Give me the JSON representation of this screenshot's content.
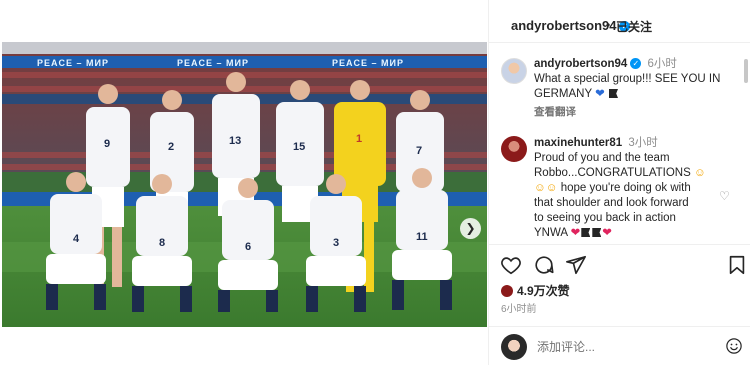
{
  "photo": {
    "banner_texts": [
      "PEACE – МИР",
      "PEACE – МИР",
      "PEACE – МИР"
    ],
    "back_row_numbers": [
      "9",
      "2",
      "13",
      "15",
      "1",
      "7"
    ],
    "front_row_numbers": [
      "4",
      "8",
      "6",
      "3",
      "11"
    ],
    "slide_count": 6,
    "active_slide": 1
  },
  "header": {
    "username": "andyrobertson94",
    "separator": "•",
    "follow_status": "已关注"
  },
  "comments": [
    {
      "username": "andyrobertson94",
      "time": "6小时",
      "text_line1": "What a special group!!! SEE YOU IN",
      "text_line2": "GERMANY",
      "translate": "查看翻译"
    },
    {
      "username": "maxinehunter81",
      "time": "3小时",
      "text_a": "Proud of you and the team",
      "text_b": "Robbo...CONGRATULATIONS",
      "text_c": "hope you're doing ok with",
      "text_d": "that shoulder and look forward",
      "text_e": "to seeing you back in action",
      "text_f": "YNWA"
    }
  ],
  "likes": "4.9万次赞",
  "post_time": "6小时前",
  "add_comment": {
    "placeholder": "添加评论..."
  },
  "colors": {
    "verified": "#0095f6",
    "heart": "#e0245e",
    "muted": "#8e8e8e"
  }
}
